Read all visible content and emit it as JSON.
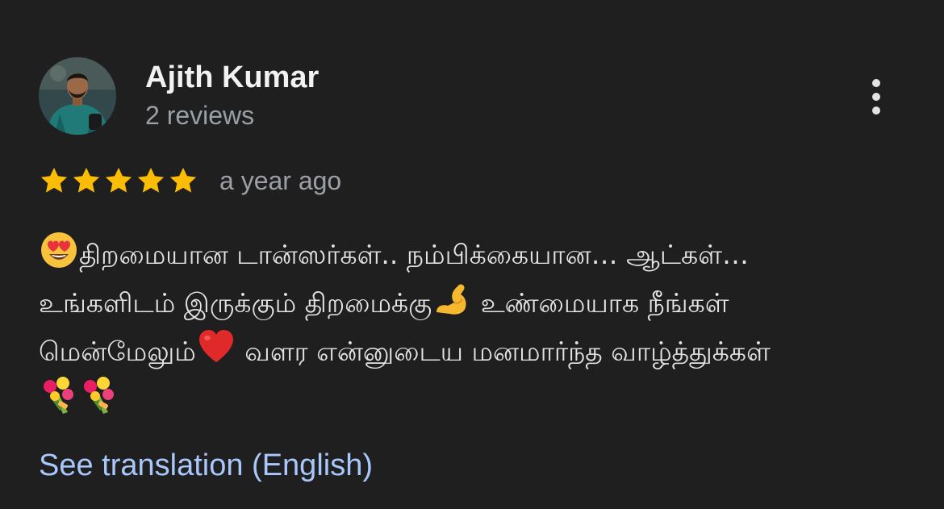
{
  "review": {
    "author": {
      "name": "Ajith Kumar",
      "meta": "2 reviews",
      "avatar_icon": "profile-photo"
    },
    "rating": 5,
    "rating_max": 5,
    "date": "a year ago",
    "text_lines": [
      "திறமையான டான்ஸர்கள்.. நம்பிக்கையான… ஆட்கள்…",
      "உங்களிடம் இருக்கும் திறமைக்கு",
      "உண்மையாக நீங்கள்",
      "மென்மேலும்",
      "வளர என்னுடைய மனமார்ந்த வாழ்த்துக்கள்"
    ],
    "emojis": [
      "heart-eyes-emoji",
      "flexed-biceps-emoji",
      "red-heart-emoji",
      "bouquet-emoji"
    ],
    "translation_link": "See translation (English)"
  },
  "colors": {
    "background": "#1f1f1f",
    "star": "#fbbc04",
    "link": "#a8c7fa",
    "secondary_text": "#9aa0a6"
  }
}
